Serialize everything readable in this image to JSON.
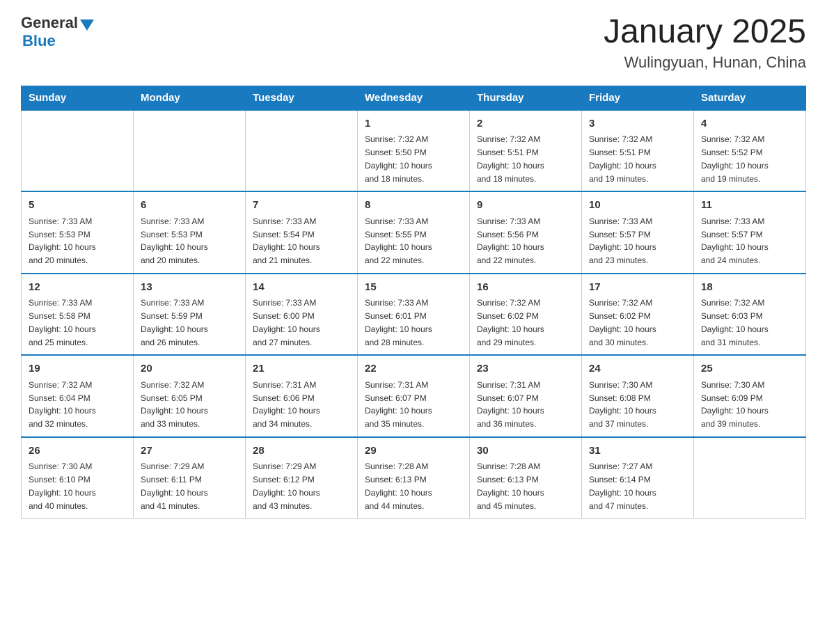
{
  "header": {
    "logo_general": "General",
    "logo_blue": "Blue",
    "title": "January 2025",
    "subtitle": "Wulingyuan, Hunan, China"
  },
  "days_of_week": [
    "Sunday",
    "Monday",
    "Tuesday",
    "Wednesday",
    "Thursday",
    "Friday",
    "Saturday"
  ],
  "weeks": [
    [
      {
        "day": "",
        "info": ""
      },
      {
        "day": "",
        "info": ""
      },
      {
        "day": "",
        "info": ""
      },
      {
        "day": "1",
        "info": "Sunrise: 7:32 AM\nSunset: 5:50 PM\nDaylight: 10 hours\nand 18 minutes."
      },
      {
        "day": "2",
        "info": "Sunrise: 7:32 AM\nSunset: 5:51 PM\nDaylight: 10 hours\nand 18 minutes."
      },
      {
        "day": "3",
        "info": "Sunrise: 7:32 AM\nSunset: 5:51 PM\nDaylight: 10 hours\nand 19 minutes."
      },
      {
        "day": "4",
        "info": "Sunrise: 7:32 AM\nSunset: 5:52 PM\nDaylight: 10 hours\nand 19 minutes."
      }
    ],
    [
      {
        "day": "5",
        "info": "Sunrise: 7:33 AM\nSunset: 5:53 PM\nDaylight: 10 hours\nand 20 minutes."
      },
      {
        "day": "6",
        "info": "Sunrise: 7:33 AM\nSunset: 5:53 PM\nDaylight: 10 hours\nand 20 minutes."
      },
      {
        "day": "7",
        "info": "Sunrise: 7:33 AM\nSunset: 5:54 PM\nDaylight: 10 hours\nand 21 minutes."
      },
      {
        "day": "8",
        "info": "Sunrise: 7:33 AM\nSunset: 5:55 PM\nDaylight: 10 hours\nand 22 minutes."
      },
      {
        "day": "9",
        "info": "Sunrise: 7:33 AM\nSunset: 5:56 PM\nDaylight: 10 hours\nand 22 minutes."
      },
      {
        "day": "10",
        "info": "Sunrise: 7:33 AM\nSunset: 5:57 PM\nDaylight: 10 hours\nand 23 minutes."
      },
      {
        "day": "11",
        "info": "Sunrise: 7:33 AM\nSunset: 5:57 PM\nDaylight: 10 hours\nand 24 minutes."
      }
    ],
    [
      {
        "day": "12",
        "info": "Sunrise: 7:33 AM\nSunset: 5:58 PM\nDaylight: 10 hours\nand 25 minutes."
      },
      {
        "day": "13",
        "info": "Sunrise: 7:33 AM\nSunset: 5:59 PM\nDaylight: 10 hours\nand 26 minutes."
      },
      {
        "day": "14",
        "info": "Sunrise: 7:33 AM\nSunset: 6:00 PM\nDaylight: 10 hours\nand 27 minutes."
      },
      {
        "day": "15",
        "info": "Sunrise: 7:33 AM\nSunset: 6:01 PM\nDaylight: 10 hours\nand 28 minutes."
      },
      {
        "day": "16",
        "info": "Sunrise: 7:32 AM\nSunset: 6:02 PM\nDaylight: 10 hours\nand 29 minutes."
      },
      {
        "day": "17",
        "info": "Sunrise: 7:32 AM\nSunset: 6:02 PM\nDaylight: 10 hours\nand 30 minutes."
      },
      {
        "day": "18",
        "info": "Sunrise: 7:32 AM\nSunset: 6:03 PM\nDaylight: 10 hours\nand 31 minutes."
      }
    ],
    [
      {
        "day": "19",
        "info": "Sunrise: 7:32 AM\nSunset: 6:04 PM\nDaylight: 10 hours\nand 32 minutes."
      },
      {
        "day": "20",
        "info": "Sunrise: 7:32 AM\nSunset: 6:05 PM\nDaylight: 10 hours\nand 33 minutes."
      },
      {
        "day": "21",
        "info": "Sunrise: 7:31 AM\nSunset: 6:06 PM\nDaylight: 10 hours\nand 34 minutes."
      },
      {
        "day": "22",
        "info": "Sunrise: 7:31 AM\nSunset: 6:07 PM\nDaylight: 10 hours\nand 35 minutes."
      },
      {
        "day": "23",
        "info": "Sunrise: 7:31 AM\nSunset: 6:07 PM\nDaylight: 10 hours\nand 36 minutes."
      },
      {
        "day": "24",
        "info": "Sunrise: 7:30 AM\nSunset: 6:08 PM\nDaylight: 10 hours\nand 37 minutes."
      },
      {
        "day": "25",
        "info": "Sunrise: 7:30 AM\nSunset: 6:09 PM\nDaylight: 10 hours\nand 39 minutes."
      }
    ],
    [
      {
        "day": "26",
        "info": "Sunrise: 7:30 AM\nSunset: 6:10 PM\nDaylight: 10 hours\nand 40 minutes."
      },
      {
        "day": "27",
        "info": "Sunrise: 7:29 AM\nSunset: 6:11 PM\nDaylight: 10 hours\nand 41 minutes."
      },
      {
        "day": "28",
        "info": "Sunrise: 7:29 AM\nSunset: 6:12 PM\nDaylight: 10 hours\nand 43 minutes."
      },
      {
        "day": "29",
        "info": "Sunrise: 7:28 AM\nSunset: 6:13 PM\nDaylight: 10 hours\nand 44 minutes."
      },
      {
        "day": "30",
        "info": "Sunrise: 7:28 AM\nSunset: 6:13 PM\nDaylight: 10 hours\nand 45 minutes."
      },
      {
        "day": "31",
        "info": "Sunrise: 7:27 AM\nSunset: 6:14 PM\nDaylight: 10 hours\nand 47 minutes."
      },
      {
        "day": "",
        "info": ""
      }
    ]
  ]
}
